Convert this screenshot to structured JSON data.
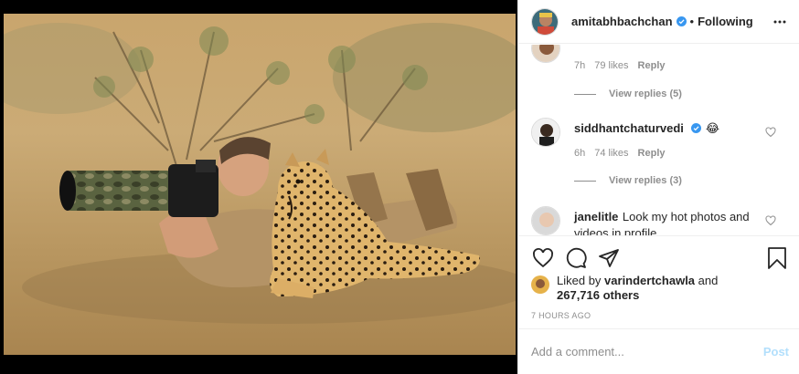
{
  "post": {
    "image_alt": "Photographer with camera lying next to a cheetah",
    "username": "amitabhbachchan",
    "follow_status": "Following",
    "separator": "•"
  },
  "comments": [
    {
      "username": "",
      "text": "",
      "time": "7h",
      "likes": "79 likes",
      "reply": "Reply",
      "view_replies": "View replies (5)"
    },
    {
      "username": "siddhantchaturvedi",
      "emoji": "😂",
      "text": "",
      "time": "6h",
      "likes": "74 likes",
      "reply": "Reply",
      "view_replies": "View replies (3)"
    },
    {
      "username": "janelitle",
      "text": "Look my hot photos and videos in profile"
    }
  ],
  "likes": {
    "prefix": "Liked by",
    "liker": "varindertchawla",
    "joiner": "and",
    "others": "267,716 others"
  },
  "timestamp": "7 HOURS AGO",
  "comment_box": {
    "placeholder": "Add a comment...",
    "post_label": "Post"
  },
  "colors": {
    "verified": "#3897f0",
    "muted": "#8e8e8e",
    "post_disabled": "#b2dffc"
  },
  "icons": [
    "heart-icon",
    "comment-icon",
    "share-icon",
    "bookmark-icon",
    "more-icon",
    "verified-icon"
  ]
}
